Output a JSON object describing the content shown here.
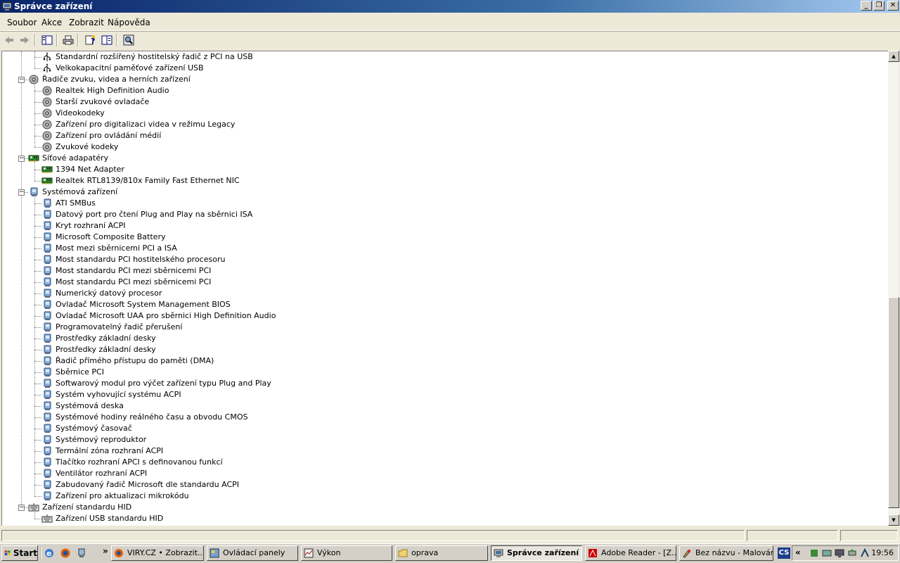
{
  "window": {
    "title": "Správce zařízení",
    "controls": {
      "minimize": "_",
      "restore": "❐",
      "close": "✕"
    }
  },
  "menu": [
    "Soubor",
    "Akce",
    "Zobrazit",
    "Nápověda"
  ],
  "tree": [
    {
      "depth": 1,
      "label": "Standardní rozšířený hostitelský řadič z PCI na USB",
      "icon": "usb-icon"
    },
    {
      "depth": 1,
      "label": "Velkokapacitní paměťové zařízení USB",
      "icon": "usb-icon"
    },
    {
      "depth": 0,
      "label": "Řadiče zvuku, videa a herních zařízení",
      "icon": "speaker-icon",
      "expander": "−"
    },
    {
      "depth": 1,
      "label": "Realtek High Definition Audio",
      "icon": "speaker-icon"
    },
    {
      "depth": 1,
      "label": "Starší zvukové ovladače",
      "icon": "speaker-icon"
    },
    {
      "depth": 1,
      "label": "Videokodeky",
      "icon": "speaker-icon"
    },
    {
      "depth": 1,
      "label": "Zařízení pro digitalizaci videa v režimu Legacy",
      "icon": "speaker-icon"
    },
    {
      "depth": 1,
      "label": "Zařízení pro ovládání médií",
      "icon": "speaker-icon"
    },
    {
      "depth": 1,
      "label": "Zvukové kodeky",
      "icon": "speaker-icon"
    },
    {
      "depth": 0,
      "label": "Síťové adapatéry",
      "icon": "network-card-icon",
      "expander": "−"
    },
    {
      "depth": 1,
      "label": "1394 Net Adapter",
      "icon": "network-card-icon"
    },
    {
      "depth": 1,
      "label": "Realtek RTL8139/810x Family Fast Ethernet NIC",
      "icon": "network-card-icon"
    },
    {
      "depth": 0,
      "label": "Systémová zařízení",
      "icon": "computer-icon",
      "expander": "−"
    },
    {
      "depth": 1,
      "label": "ATI SMBus",
      "icon": "computer-icon"
    },
    {
      "depth": 1,
      "label": "Datový port pro čtení Plug and Play na sběrnici ISA",
      "icon": "computer-icon"
    },
    {
      "depth": 1,
      "label": "Kryt rozhraní ACPI",
      "icon": "computer-icon"
    },
    {
      "depth": 1,
      "label": "Microsoft Composite Battery",
      "icon": "computer-icon"
    },
    {
      "depth": 1,
      "label": "Most mezi sběrnicemi PCI a ISA",
      "icon": "computer-icon"
    },
    {
      "depth": 1,
      "label": "Most standardu PCI hostitelského procesoru",
      "icon": "computer-icon"
    },
    {
      "depth": 1,
      "label": "Most standardu PCI mezi sběrnicemi PCI",
      "icon": "computer-icon"
    },
    {
      "depth": 1,
      "label": "Most standardu PCI mezi sběrnicemi PCI",
      "icon": "computer-icon"
    },
    {
      "depth": 1,
      "label": "Numerický datový procesor",
      "icon": "computer-icon"
    },
    {
      "depth": 1,
      "label": "Ovladač Microsoft System Management BIOS",
      "icon": "computer-icon"
    },
    {
      "depth": 1,
      "label": "Ovladač Microsoft UAA pro sběrnici High Definition Audio",
      "icon": "computer-icon"
    },
    {
      "depth": 1,
      "label": "Programovatelný řadič přerušení",
      "icon": "computer-icon"
    },
    {
      "depth": 1,
      "label": "Prostředky základní desky",
      "icon": "computer-icon"
    },
    {
      "depth": 1,
      "label": "Prostředky základní desky",
      "icon": "computer-icon"
    },
    {
      "depth": 1,
      "label": "Řadič přímého přístupu do paměti (DMA)",
      "icon": "computer-icon"
    },
    {
      "depth": 1,
      "label": "Sběrnice PCI",
      "icon": "computer-icon"
    },
    {
      "depth": 1,
      "label": "Softwarový modul pro výčet zařízení typu Plug and Play",
      "icon": "computer-icon"
    },
    {
      "depth": 1,
      "label": "Systém vyhovující systému ACPI",
      "icon": "computer-icon"
    },
    {
      "depth": 1,
      "label": "Systémová deska",
      "icon": "computer-icon"
    },
    {
      "depth": 1,
      "label": "Systémové hodiny reálného času a obvodu CMOS",
      "icon": "computer-icon"
    },
    {
      "depth": 1,
      "label": "Systémový časovač",
      "icon": "computer-icon"
    },
    {
      "depth": 1,
      "label": "Systémový reproduktor",
      "icon": "computer-icon"
    },
    {
      "depth": 1,
      "label": "Termální zóna rozhraní ACPI",
      "icon": "computer-icon"
    },
    {
      "depth": 1,
      "label": "Tlačítko rozhraní APCI s definovanou funkcí",
      "icon": "computer-icon"
    },
    {
      "depth": 1,
      "label": "Ventilátor rozhraní ACPI",
      "icon": "computer-icon"
    },
    {
      "depth": 1,
      "label": "Zabudovaný řadič Microsoft dle standardu ACPI",
      "icon": "computer-icon"
    },
    {
      "depth": 1,
      "label": "Zařízení pro aktualizaci mikrokódu",
      "icon": "computer-icon"
    },
    {
      "depth": 0,
      "label": "Zařízení standardu HID",
      "icon": "keyboard-icon",
      "expander": "−"
    },
    {
      "depth": 1,
      "label": "Zařízení USB standardu HID",
      "icon": "keyboard-icon"
    }
  ],
  "taskbar": {
    "start_label": "Start",
    "chevron": "»",
    "tasks": [
      {
        "label": "VIRY.CZ • Zobrazit...",
        "icon": "firefox-icon",
        "active": false
      },
      {
        "label": "Ovládací panely",
        "icon": "control-panel-icon",
        "active": false
      },
      {
        "label": "Výkon",
        "icon": "performance-icon",
        "active": false
      },
      {
        "label": "oprava",
        "icon": "folder-icon",
        "active": false
      },
      {
        "label": "Správce zařízení",
        "icon": "device-manager-icon",
        "active": true
      },
      {
        "label": "Adobe Reader - [Z...",
        "icon": "adobe-reader-icon",
        "active": false
      },
      {
        "label": "Bez názvu - Malování",
        "icon": "paint-icon",
        "active": false
      }
    ],
    "lang": "CS",
    "tray_chevron": "«",
    "clock": "19:56"
  }
}
